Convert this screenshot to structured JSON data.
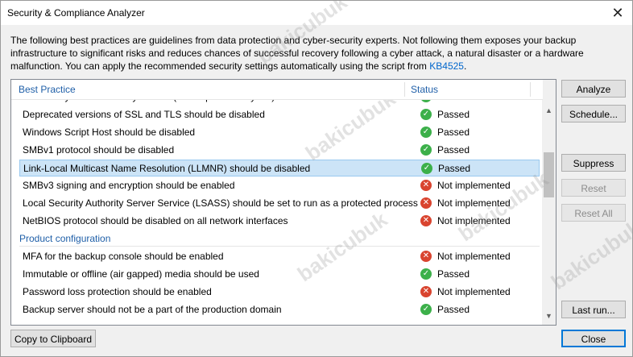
{
  "window": {
    "title": "Security & Compliance Analyzer"
  },
  "intro": {
    "text": "The following best practices are guidelines from data protection and cyber-security experts. Not following them exposes your backup infrastructure to significant risks and reduces chances of successful recovery following a cyber attack, a natural disaster or a hardware malfunction. You can apply the recommended security settings automatically using the script from ",
    "link": "KB4525",
    "after": "."
  },
  "list": {
    "columns": {
      "practice": "Best Practice",
      "status": "Status"
    },
    "rows": [
      {
        "name": "Web Proxy Auto-Discovery service (WinHttpAutoProxySvc) should be disabled",
        "status": "Passed",
        "ok": true
      },
      {
        "name": "Deprecated versions of SSL and TLS should be disabled",
        "status": "Passed",
        "ok": true
      },
      {
        "name": "Windows Script Host should be disabled",
        "status": "Passed",
        "ok": true
      },
      {
        "name": "SMBv1 protocol should be disabled",
        "status": "Passed",
        "ok": true
      },
      {
        "name": "Link-Local Multicast Name Resolution (LLMNR) should be disabled",
        "status": "Passed",
        "ok": true
      },
      {
        "name": "SMBv3 signing and encryption should be enabled",
        "status": "Not implemented",
        "ok": false
      },
      {
        "name": "Local Security Authority Server Service (LSASS) should be set to run as a protected process",
        "status": "Not implemented",
        "ok": false
      },
      {
        "name": "NetBIOS protocol should be disabled on all network interfaces",
        "status": "Not implemented",
        "ok": false
      },
      {
        "group": "Product configuration"
      },
      {
        "name": "MFA for the backup console should be enabled",
        "status": "Not implemented",
        "ok": false
      },
      {
        "name": "Immutable or offline (air gapped) media should be used",
        "status": "Passed",
        "ok": true
      },
      {
        "name": "Password loss protection should be enabled",
        "status": "Not implemented",
        "ok": false
      },
      {
        "name": "Backup server should not be a part of the production domain",
        "status": "Passed",
        "ok": true
      }
    ],
    "selected_index": 4
  },
  "buttons": {
    "analyze": "Analyze",
    "schedule": "Schedule...",
    "suppress": "Suppress",
    "reset": "Reset",
    "reset_all": "Reset All",
    "last_run": "Last run...",
    "copy": "Copy to Clipboard",
    "close": "Close"
  },
  "icons": {
    "close": "close-icon",
    "passed": "check-circle-icon",
    "failed": "x-circle-icon"
  },
  "colors": {
    "passed": "#3cb04a",
    "failed": "#d9442f",
    "selection": "#cce4f7",
    "header_text": "#1f5fa8"
  },
  "watermark": "bakicubuk"
}
